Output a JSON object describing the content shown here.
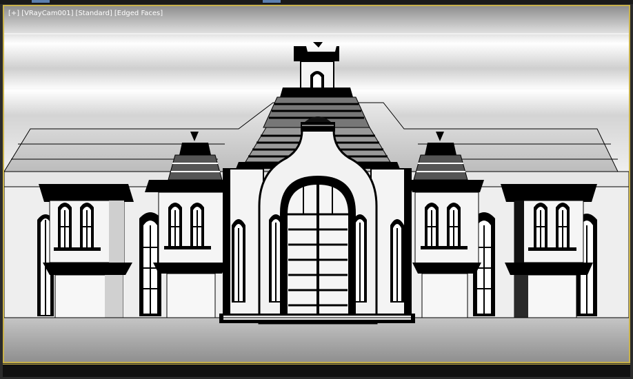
{
  "viewport": {
    "label": {
      "view_menu": "[+]",
      "camera": "[VRayCam001]",
      "shading": "[Standard]",
      "display_mode": "[Edged Faces]"
    },
    "border_color": "#c9b24a"
  },
  "colors": {
    "sky_top": "#ffffff",
    "sky_bottom": "#8c8c8c",
    "ground": "#9c9c9c",
    "wall": "#f2f2f2",
    "wall_shade": "#d6d6d6",
    "outline": "#000000"
  }
}
